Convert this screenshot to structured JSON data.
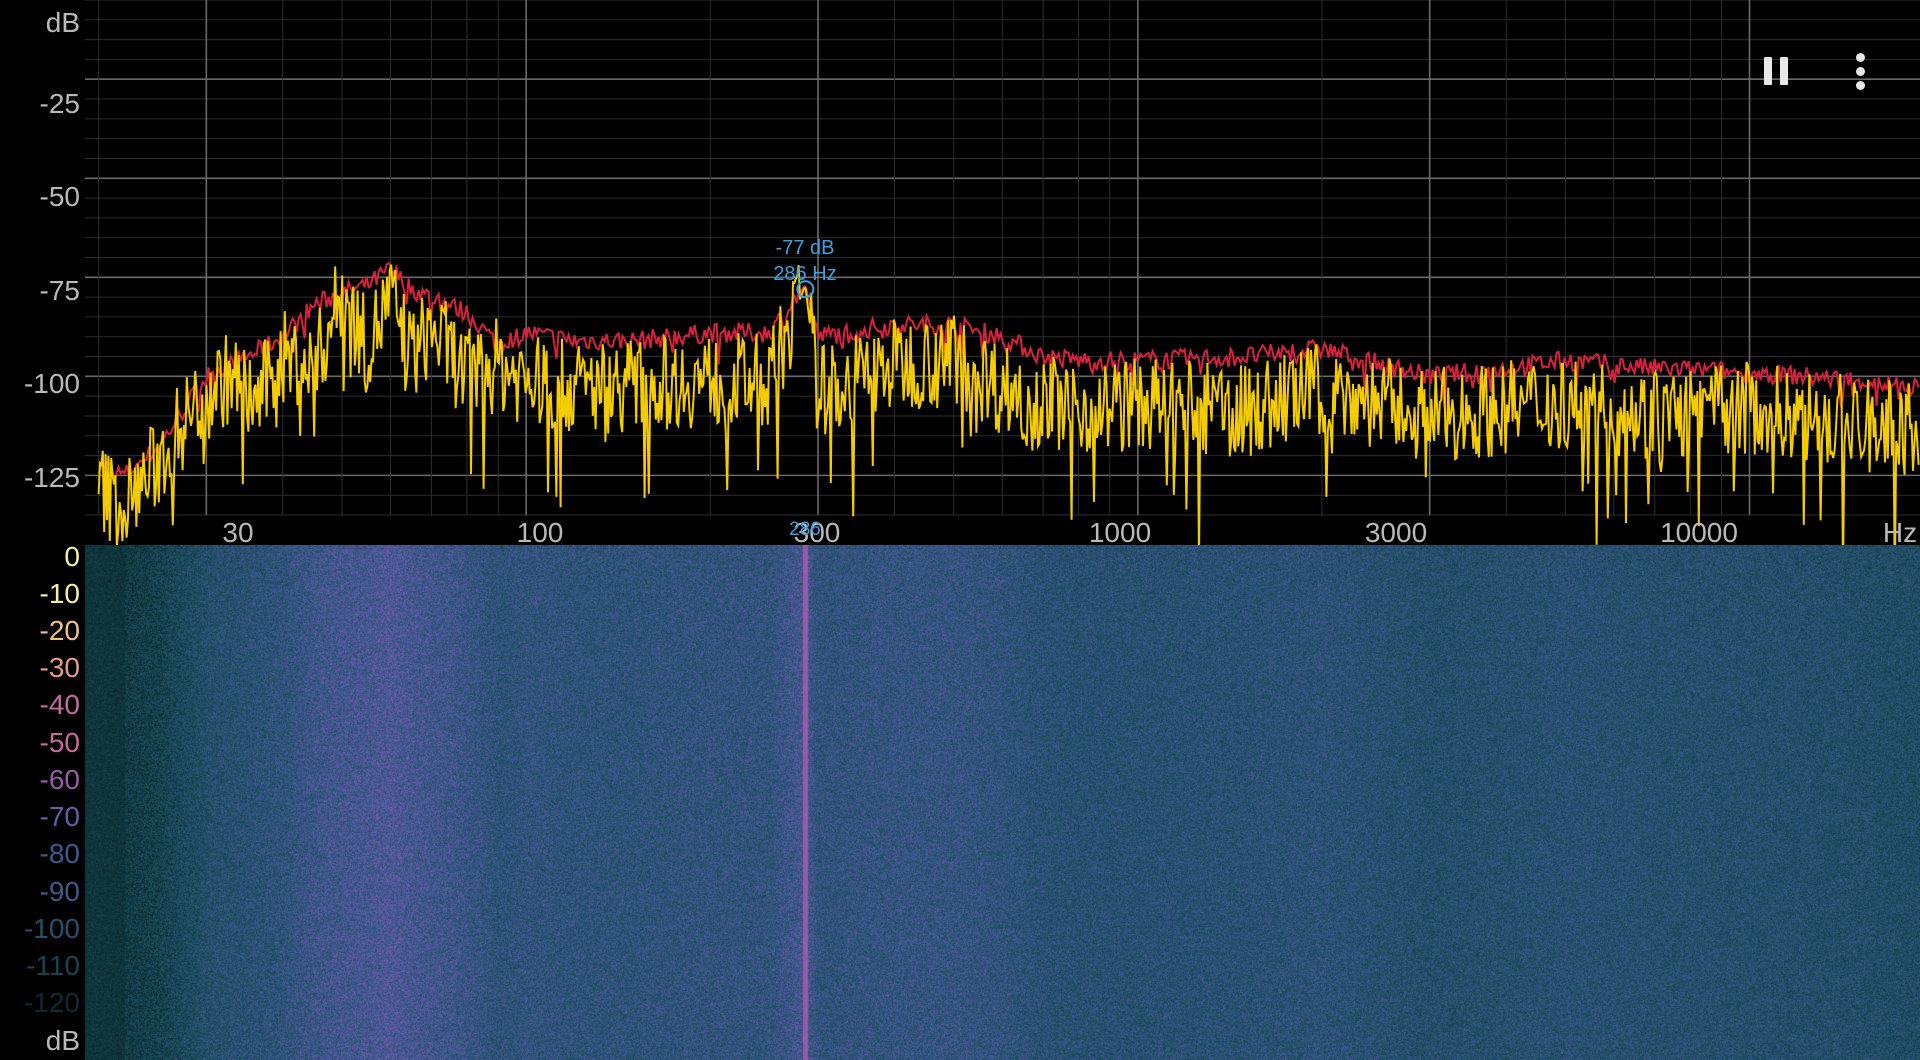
{
  "spectrum": {
    "y_unit": "dB",
    "x_unit": "Hz",
    "y_ticks": [
      "-25",
      "-50",
      "-75",
      "-100",
      "-125"
    ],
    "x_ticks": [
      "30",
      "100",
      "300",
      "1000",
      "3000",
      "10000"
    ],
    "peak": {
      "db_label": "-77 dB",
      "hz_label": "286 Hz",
      "marker_label": "286"
    },
    "colors": {
      "peak_hold": "#d8213f",
      "live": "#f5cc00",
      "grid": "#555555",
      "peak_marker": "#3aa0e0"
    }
  },
  "spectrogram": {
    "scale_labels": [
      "0",
      "-10",
      "-20",
      "-30",
      "-40",
      "-50",
      "-60",
      "-70",
      "-80",
      "-90",
      "-100",
      "-110",
      "-120"
    ],
    "unit": "dB",
    "colormap": [
      "#f4f0a0",
      "#f1c27d",
      "#e59a86",
      "#c7699a",
      "#9a5aa8",
      "#6b5aaa",
      "#3e5890",
      "#25506a",
      "#164552",
      "#0b2d30"
    ]
  },
  "toolbar": {
    "pause_icon": "pause-icon",
    "menu_icon": "more-vert-icon"
  },
  "chart_data": {
    "type": "line",
    "xlabel": "Hz",
    "ylabel": "dB",
    "x_scale": "log",
    "xlim": [
      19,
      19000
    ],
    "ylim": [
      -135,
      -5
    ],
    "x_ticks": [
      30,
      100,
      300,
      1000,
      3000,
      10000
    ],
    "y_ticks": [
      -25,
      -50,
      -75,
      -100,
      -125
    ],
    "grid": true,
    "series": [
      {
        "color": "#d8213f",
        "x": [
          20,
          22,
          25,
          30,
          35,
          40,
          45,
          50,
          55,
          60,
          65,
          70,
          75,
          80,
          90,
          100,
          120,
          150,
          200,
          250,
          286,
          300,
          400,
          500,
          600,
          700,
          800,
          1000,
          1500,
          2000,
          2500,
          3000,
          4000,
          5000,
          7000,
          10000,
          15000,
          19000
        ],
        "y": [
          -122,
          -125,
          -118,
          -100,
          -95,
          -90,
          -82,
          -79,
          -77,
          -73,
          -78,
          -80,
          -82,
          -84,
          -92,
          -89,
          -91,
          -91,
          -89,
          -89,
          -77,
          -90,
          -87,
          -87,
          -90,
          -95,
          -96,
          -96,
          -95,
          -93,
          -97,
          -100,
          -98,
          -96,
          -98,
          -99,
          -101,
          -103
        ]
      },
      {
        "color": "#f5cc00",
        "x": [
          20,
          22,
          25,
          28,
          30,
          33,
          36,
          40,
          45,
          50,
          55,
          60,
          65,
          70,
          80,
          90,
          100,
          120,
          150,
          200,
          250,
          286,
          300,
          400,
          500,
          600,
          700,
          800,
          1000,
          1500,
          2000,
          2500,
          3000,
          4000,
          5000,
          7000,
          10000,
          15000,
          19000
        ],
        "y": [
          -128,
          -133,
          -122,
          -110,
          -104,
          -100,
          -107,
          -95,
          -98,
          -79,
          -93,
          -80,
          -95,
          -88,
          -100,
          -97,
          -101,
          -103,
          -102,
          -101,
          -101,
          -77,
          -104,
          -97,
          -95,
          -103,
          -106,
          -108,
          -107,
          -109,
          -103,
          -107,
          -110,
          -108,
          -106,
          -110,
          -108,
          -112,
          -114
        ]
      }
    ]
  }
}
